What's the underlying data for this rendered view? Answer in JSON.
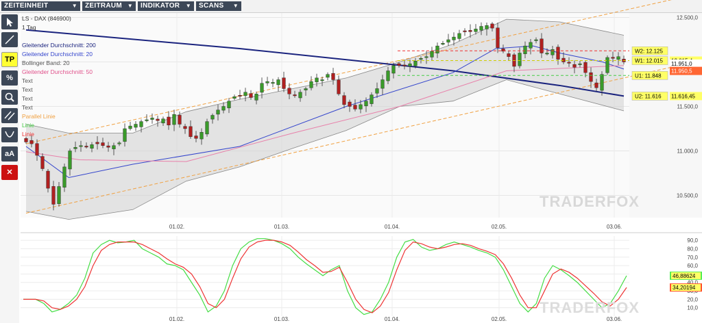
{
  "menu": [
    {
      "label": "ZEITEINHEIT",
      "x": 2,
      "w": 115
    },
    {
      "label": "ZEITRAUM",
      "x": 120,
      "w": 78
    },
    {
      "label": "INDIKATOR",
      "x": 201,
      "w": 82
    },
    {
      "label": "SCANS",
      "x": 286,
      "w": 66
    }
  ],
  "tools": [
    {
      "name": "pointer-tool",
      "label": ""
    },
    {
      "name": "line-tool",
      "label": ""
    },
    {
      "name": "tp-tool",
      "label": "TP"
    },
    {
      "name": "percent-tool",
      "label": "%"
    },
    {
      "name": "search-tool",
      "label": ""
    },
    {
      "name": "parallel-tool",
      "label": ""
    },
    {
      "name": "curve-tool",
      "label": ""
    },
    {
      "name": "text-tool",
      "label": "aA"
    },
    {
      "name": "delete-tool",
      "label": "✕"
    }
  ],
  "legend": [
    {
      "text": "LS - DAX (846900)",
      "color": "#333333"
    },
    {
      "text": "1 Tag",
      "color": "#333333"
    },
    {
      "text": "",
      "color": "#333333"
    },
    {
      "text": "Gleitender Durchschnitt: 200",
      "color": "#1a237e"
    },
    {
      "text": "Gleitender Durchschnitt: 20",
      "color": "#3344cc"
    },
    {
      "text": "Bollinger Band: 20",
      "color": "#555555"
    },
    {
      "text": "Gleitender Durchschnitt: 50",
      "color": "#e0508a"
    },
    {
      "text": "Text",
      "color": "#555555"
    },
    {
      "text": "Text",
      "color": "#555555"
    },
    {
      "text": "Text",
      "color": "#555555"
    },
    {
      "text": "Text",
      "color": "#555555"
    },
    {
      "text": "Parallel Linie",
      "color": "#f0a040"
    },
    {
      "text": "Linie",
      "color": "#44cc44"
    },
    {
      "text": "Linie",
      "color": "#ee3333"
    }
  ],
  "watermark": "TRADERFOX",
  "chart_data": [
    {
      "type": "candlestick",
      "title": "LS - DAX (846900)",
      "timeframe": "1 Tag",
      "x_ticks": [
        "01.02.",
        "01.03.",
        "01.04.",
        "02.05.",
        "03.06."
      ],
      "ylim": [
        10250,
        12550
      ],
      "y_ticks": [
        10500,
        11000,
        11500,
        12000,
        12500
      ],
      "y_tick_labels": [
        "10.500,0",
        "11.000,0",
        "11.500,0",
        "12.000,0",
        "12.500,0"
      ],
      "closes": [
        11100,
        11080,
        10950,
        10800,
        10580,
        10400,
        10600,
        10820,
        11000,
        11040,
        11060,
        11050,
        11070,
        11080,
        11060,
        11040,
        11060,
        11090,
        11250,
        11280,
        11300,
        11330,
        11350,
        11370,
        11340,
        11360,
        11290,
        11410,
        11300,
        11250,
        11160,
        11140,
        11210,
        11330,
        11400,
        11460,
        11500,
        11560,
        11610,
        11620,
        11660,
        11600,
        11640,
        11760,
        11780,
        11770,
        11800,
        11700,
        11640,
        11620,
        11660,
        11700,
        11780,
        11820,
        11800,
        11860,
        11800,
        11640,
        11520,
        11500,
        11470,
        11520,
        11560,
        11630,
        11700,
        11800,
        11900,
        11960,
        11960,
        11960,
        11980,
        12010,
        12040,
        12060,
        12120,
        12180,
        12210,
        12250,
        12280,
        12320,
        12340,
        12340,
        12370,
        12400,
        12410,
        12380,
        12160,
        12120,
        12060,
        11950,
        12100,
        12180,
        12220,
        12250,
        12100,
        12100,
        12140,
        12030,
        12000,
        11990,
        11940,
        11980,
        11880,
        11780,
        11710,
        11860,
        12050,
        12040,
        12060,
        12000
      ],
      "opens_note": "",
      "series": [
        {
          "name": "Gleitender Durchschnitt: 200",
          "values": [
            [
              0,
              12360
            ],
            [
              40,
              12150
            ],
            [
              80,
              11900
            ],
            [
              100,
              11735
            ],
            [
              112,
              11616
            ]
          ]
        },
        {
          "name": "Gleitender Durchschnitt: 20",
          "values": [
            [
              0,
              11050
            ],
            [
              8,
              10700
            ],
            [
              20,
              10850
            ],
            [
              40,
              11050
            ],
            [
              60,
              11500
            ],
            [
              80,
              11880
            ],
            [
              88,
              12150
            ],
            [
              95,
              12180
            ],
            [
              100,
              12100
            ],
            [
              108,
              12000
            ],
            [
              112,
              11920
            ]
          ]
        },
        {
          "name": "Gleitender Durchschnitt: 50",
          "values": [
            [
              0,
              10990
            ],
            [
              10,
              10900
            ],
            [
              30,
              10880
            ],
            [
              50,
              11200
            ],
            [
              70,
              11500
            ],
            [
              90,
              11900
            ],
            [
              112,
              11960
            ]
          ]
        },
        {
          "name": "Bollinger Band: 20 (oben)",
          "values": [
            [
              0,
              11300
            ],
            [
              8,
              11200
            ],
            [
              20,
              11200
            ],
            [
              30,
              11440
            ],
            [
              40,
              11580
            ],
            [
              50,
              11700
            ],
            [
              60,
              11820
            ],
            [
              70,
              12000
            ],
            [
              80,
              12200
            ],
            [
              90,
              12480
            ],
            [
              100,
              12450
            ],
            [
              112,
              12300
            ]
          ]
        },
        {
          "name": "Bollinger Band: 20 (unten)",
          "values": [
            [
              0,
              10320
            ],
            [
              8,
              10230
            ],
            [
              20,
              10340
            ],
            [
              30,
              10660
            ],
            [
              40,
              10820
            ],
            [
              50,
              11030
            ],
            [
              60,
              11230
            ],
            [
              70,
              11500
            ],
            [
              80,
              11560
            ],
            [
              90,
              11800
            ],
            [
              100,
              11640
            ],
            [
              112,
              11450
            ]
          ]
        }
      ],
      "channel": {
        "name": "Parallel Linie",
        "upper": [
          [
            0,
            11080
          ],
          [
            112,
            12580
          ]
        ],
        "lower": [
          [
            0,
            10300
          ],
          [
            112,
            11820
          ]
        ]
      },
      "levels": [
        {
          "label": "W2: 12.125",
          "value": 12125,
          "color": "#ee3333"
        },
        {
          "label": "W1: 12.015",
          "value": 12015,
          "color": "#cccc00"
        },
        {
          "label": "U1: 11.848",
          "value": 11848,
          "color": "#44cc44"
        },
        {
          "label": "U2: 11.616",
          "value": 11616,
          "color": "#1a237e"
        }
      ],
      "price_tags": [
        {
          "text": "12.015,4",
          "bg": "#ffff66",
          "fg": "#000000",
          "value": 12015
        },
        {
          "text": "11.951,0",
          "bg": "#ffffff",
          "fg": "#000000",
          "value": 11951
        },
        {
          "text": "11.950,5",
          "bg": "#ff6633",
          "fg": "#ffffff",
          "value": 11930
        },
        {
          "text": "11.616,45",
          "bg": "#ffff66",
          "fg": "#000000",
          "value": 11616
        }
      ]
    },
    {
      "type": "line",
      "title": "",
      "x_ticks": [
        "01.02.",
        "01.03.",
        "01.04.",
        "02.05.",
        "03.06."
      ],
      "ylim": [
        0,
        95
      ],
      "y_ticks": [
        10,
        20,
        30,
        40,
        50,
        60,
        70,
        80,
        90
      ],
      "y_tick_labels": [
        "10,0",
        "20,0",
        "30,0",
        "40,0",
        "50,0",
        "60,0",
        "70,0",
        "80,0",
        "90,0"
      ],
      "series": [
        {
          "name": "",
          "color": "#44dd44",
          "last_label": "46,88624",
          "values": [
            [
              0,
              20
            ],
            [
              3,
              20
            ],
            [
              5,
              15
            ],
            [
              7,
              5
            ],
            [
              9,
              8
            ],
            [
              11,
              15
            ],
            [
              13,
              25
            ],
            [
              15,
              45
            ],
            [
              17,
              75
            ],
            [
              19,
              85
            ],
            [
              21,
              90
            ],
            [
              23,
              87
            ],
            [
              25,
              88
            ],
            [
              27,
              90
            ],
            [
              29,
              80
            ],
            [
              31,
              75
            ],
            [
              33,
              70
            ],
            [
              35,
              62
            ],
            [
              37,
              60
            ],
            [
              39,
              55
            ],
            [
              41,
              40
            ],
            [
              43,
              25
            ],
            [
              45,
              5
            ],
            [
              47,
              12
            ],
            [
              49,
              30
            ],
            [
              51,
              60
            ],
            [
              53,
              80
            ],
            [
              55,
              88
            ],
            [
              57,
              92
            ],
            [
              59,
              92
            ],
            [
              61,
              90
            ],
            [
              63,
              86
            ],
            [
              65,
              80
            ],
            [
              67,
              70
            ],
            [
              69,
              62
            ],
            [
              71,
              55
            ],
            [
              73,
              48
            ],
            [
              75,
              55
            ],
            [
              77,
              60
            ],
            [
              79,
              30
            ],
            [
              81,
              10
            ],
            [
              83,
              2
            ],
            [
              85,
              5
            ],
            [
              87,
              20
            ],
            [
              89,
              40
            ],
            [
              91,
              70
            ],
            [
              93,
              88
            ],
            [
              95,
              91
            ],
            [
              97,
              82
            ],
            [
              99,
              78
            ],
            [
              101,
              80
            ],
            [
              103,
              85
            ],
            [
              105,
              88
            ],
            [
              107,
              85
            ],
            [
              109,
              82
            ],
            [
              111,
              78
            ],
            [
              113,
              75
            ],
            [
              115,
              70
            ],
            [
              117,
              55
            ],
            [
              119,
              35
            ],
            [
              121,
              15
            ],
            [
              123,
              5
            ],
            [
              125,
              15
            ],
            [
              127,
              45
            ],
            [
              129,
              60
            ],
            [
              131,
              55
            ],
            [
              133,
              48
            ],
            [
              135,
              40
            ],
            [
              137,
              30
            ],
            [
              139,
              20
            ],
            [
              141,
              10
            ],
            [
              143,
              15
            ],
            [
              145,
              30
            ],
            [
              147,
              48
            ]
          ]
        },
        {
          "name": "",
          "color": "#ee3333",
          "last_label": "34,20194",
          "values": [
            [
              0,
              20
            ],
            [
              3,
              20
            ],
            [
              5,
              18
            ],
            [
              7,
              10
            ],
            [
              9,
              8
            ],
            [
              11,
              12
            ],
            [
              13,
              20
            ],
            [
              15,
              35
            ],
            [
              17,
              60
            ],
            [
              19,
              78
            ],
            [
              21,
              85
            ],
            [
              23,
              88
            ],
            [
              25,
              88
            ],
            [
              27,
              88
            ],
            [
              29,
              85
            ],
            [
              31,
              80
            ],
            [
              33,
              75
            ],
            [
              35,
              68
            ],
            [
              37,
              62
            ],
            [
              39,
              58
            ],
            [
              41,
              50
            ],
            [
              43,
              35
            ],
            [
              45,
              15
            ],
            [
              47,
              10
            ],
            [
              49,
              20
            ],
            [
              51,
              45
            ],
            [
              53,
              68
            ],
            [
              55,
              82
            ],
            [
              57,
              88
            ],
            [
              59,
              90
            ],
            [
              61,
              90
            ],
            [
              63,
              88
            ],
            [
              65,
              84
            ],
            [
              67,
              76
            ],
            [
              69,
              67
            ],
            [
              71,
              60
            ],
            [
              73,
              52
            ],
            [
              75,
              53
            ],
            [
              77,
              58
            ],
            [
              79,
              40
            ],
            [
              81,
              20
            ],
            [
              83,
              8
            ],
            [
              85,
              4
            ],
            [
              87,
              12
            ],
            [
              89,
              28
            ],
            [
              91,
              55
            ],
            [
              93,
              78
            ],
            [
              95,
              88
            ],
            [
              97,
              86
            ],
            [
              99,
              82
            ],
            [
              101,
              80
            ],
            [
              103,
              82
            ],
            [
              105,
              85
            ],
            [
              107,
              86
            ],
            [
              109,
              84
            ],
            [
              111,
              80
            ],
            [
              113,
              77
            ],
            [
              115,
              73
            ],
            [
              117,
              62
            ],
            [
              119,
              45
            ],
            [
              121,
              25
            ],
            [
              123,
              10
            ],
            [
              125,
              10
            ],
            [
              127,
              30
            ],
            [
              129,
              50
            ],
            [
              131,
              56
            ],
            [
              133,
              52
            ],
            [
              135,
              45
            ],
            [
              137,
              36
            ],
            [
              139,
              27
            ],
            [
              141,
              17
            ],
            [
              143,
              12
            ],
            [
              145,
              20
            ],
            [
              147,
              34
            ]
          ]
        }
      ]
    }
  ]
}
